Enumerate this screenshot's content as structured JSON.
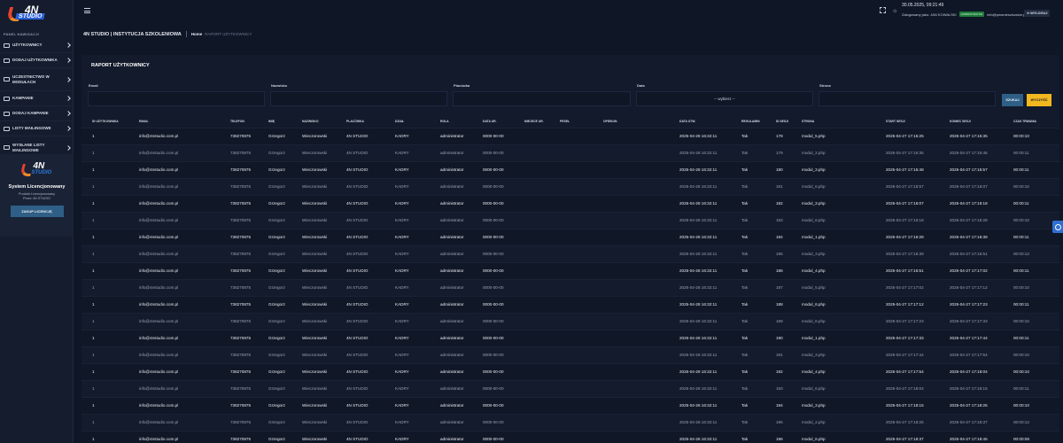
{
  "sidebar": {
    "logo": {
      "mark": "4N",
      "word": "STUDIO"
    },
    "nav_header": "PANEL NAWIGACJI",
    "items": [
      {
        "label": "UŻYTKOWNICY"
      },
      {
        "label": "DODAJ UŻYTKOWNIKA"
      },
      {
        "label": "UCZESTNICTWO W MODUŁACH"
      },
      {
        "label": "KAMPANIE"
      },
      {
        "label": "DODAJ KAMPANIE"
      },
      {
        "label": "LISTY MAILINGOWE"
      },
      {
        "label": "WYSŁANE LISTY MAILINGOWE"
      }
    ],
    "license": {
      "logo_mark": "4N",
      "logo_word": "STUDIO",
      "title": "System Licencjonowany",
      "line1": "Produkt Licencjonowany",
      "line2": "Przez 4N STUDIO",
      "button": "ZAKUP LICENCJĘ"
    }
  },
  "topbar": {
    "datetime": "30.05.2025, 09:21:49",
    "logged_prefix": "Zalogowany jako: JAN KOWALSKI",
    "badge": "ADMINISTRATOR",
    "email": "info@pmanieszkowice.pl",
    "logout": "WYLOGUJ"
  },
  "breadcrumb": {
    "company": "4N STUDIO | INSTYTUCJA SZKOLENIOWA",
    "home": "Home",
    "current": "RAPORT UŻYTKOWNICY"
  },
  "report": {
    "title": "RAPORT UŻYTKOWNICY",
    "filters": {
      "email_label": "Email",
      "surname_label": "Nazwisko",
      "branch_label": "Placówka",
      "date_label": "Data",
      "date_value": "-- wybierz --",
      "page_label": "Strona",
      "search_btn": "SZUKAJ",
      "clear_btn": "WYCZYŚĆ"
    },
    "columns": [
      "ID UŻYTKOWNIKA",
      "EMAIL",
      "TELEFON",
      "IMIĘ",
      "NAZWISKO",
      "PLACÓWKA",
      "DZIAŁ",
      "ROLA",
      "DATA UR.",
      "MIEJSCE UR.",
      "PESEL",
      "OPIEKUN",
      "DATA UTW.",
      "REGULAMIN",
      "ID SESJI",
      "STRONA",
      "START SESJI",
      "KONIEC SESJI",
      "CZAS TRWANIA"
    ],
    "rows": [
      [
        "1",
        "info@4nstudio.com.pl",
        "738270875",
        "Grzegorz",
        "Wieczorowski",
        "4N STUDIO",
        "KADRY",
        "administrator",
        "0000-00-00",
        "",
        "",
        "",
        "2025-04-28 16:32:11",
        "Tak",
        "178",
        "modul_5.php",
        "2025-04-27 17:15:25",
        "2025-04-27 17:15:35",
        "00:00:10"
      ],
      [
        "1",
        "info@4nstudio.com.pl",
        "738270875",
        "Grzegorz",
        "Wieczorowski",
        "4N STUDIO",
        "KADRY",
        "administrator",
        "0000-00-00",
        "",
        "",
        "",
        "2025-04-28 16:32:11",
        "Tak",
        "179",
        "modul_2.php",
        "2025-04-27 17:15:35",
        "2025-04-27 17:15:46",
        "00:00:11"
      ],
      [
        "1",
        "info@4nstudio.com.pl",
        "738270875",
        "Grzegorz",
        "Wieczorowski",
        "4N STUDIO",
        "KADRY",
        "administrator",
        "0000-00-00",
        "",
        "",
        "",
        "2025-04-28 16:32:11",
        "Tak",
        "180",
        "modul_3.php",
        "2025-04-27 17:15:48",
        "2025-04-27 17:15:57",
        "00:00:11"
      ],
      [
        "1",
        "info@4nstudio.com.pl",
        "738270875",
        "Grzegorz",
        "Wieczorowski",
        "4N STUDIO",
        "KADRY",
        "administrator",
        "0000-00-00",
        "",
        "",
        "",
        "2025-04-28 16:32:11",
        "Tak",
        "181",
        "modul_6.php",
        "2025-04-27 17:15:57",
        "2025-04-27 17:16:07",
        "00:00:10"
      ],
      [
        "1",
        "info@4nstudio.com.pl",
        "738270875",
        "Grzegorz",
        "Wieczorowski",
        "4N STUDIO",
        "KADRY",
        "administrator",
        "0000-00-00",
        "",
        "",
        "",
        "2025-04-28 16:32:11",
        "Tak",
        "182",
        "modul_3.php",
        "2025-04-27 17:16:07",
        "2025-04-27 17:16:18",
        "00:00:11"
      ],
      [
        "1",
        "info@4nstudio.com.pl",
        "738270875",
        "Grzegorz",
        "Wieczorowski",
        "4N STUDIO",
        "KADRY",
        "administrator",
        "0000-00-00",
        "",
        "",
        "",
        "2025-04-28 16:32:11",
        "Tak",
        "183",
        "modul_6.php",
        "2025-04-27 17:16:18",
        "2025-04-27 17:16:28",
        "00:00:10"
      ],
      [
        "1",
        "info@4nstudio.com.pl",
        "738270875",
        "Grzegorz",
        "Wieczorowski",
        "4N STUDIO",
        "KADRY",
        "administrator",
        "0000-00-00",
        "",
        "",
        "",
        "2025-04-28 16:32:11",
        "Tak",
        "184",
        "modul_1.php",
        "2025-04-27 17:16:28",
        "2025-04-27 17:16:39",
        "00:00:11"
      ],
      [
        "1",
        "info@4nstudio.com.pl",
        "738270875",
        "Grzegorz",
        "Wieczorowski",
        "4N STUDIO",
        "KADRY",
        "administrator",
        "0000-00-00",
        "",
        "",
        "",
        "2025-04-28 16:32:11",
        "Tak",
        "185",
        "modul_3.php",
        "2025-04-27 17:16:39",
        "2025-04-27 17:16:51",
        "00:00:12"
      ],
      [
        "1",
        "info@4nstudio.com.pl",
        "738270875",
        "Grzegorz",
        "Wieczorowski",
        "4N STUDIO",
        "KADRY",
        "administrator",
        "0000-00-00",
        "",
        "",
        "",
        "2025-04-28 16:32:11",
        "Tak",
        "186",
        "modul_4.php",
        "2025-04-27 17:16:51",
        "2025-04-27 17:17:02",
        "00:00:11"
      ],
      [
        "1",
        "info@4nstudio.com.pl",
        "738270875",
        "Grzegorz",
        "Wieczorowski",
        "4N STUDIO",
        "KADRY",
        "administrator",
        "0000-00-00",
        "",
        "",
        "",
        "2025-04-28 16:32:11",
        "Tak",
        "187",
        "modul_5.php",
        "2025-04-27 17:17:02",
        "2025-04-27 17:17:12",
        "00:00:10"
      ],
      [
        "1",
        "info@4nstudio.com.pl",
        "738270875",
        "Grzegorz",
        "Wieczorowski",
        "4N STUDIO",
        "KADRY",
        "administrator",
        "0000-00-00",
        "",
        "",
        "",
        "2025-04-28 16:32:11",
        "Tak",
        "188",
        "modul_6.php",
        "2025-04-27 17:17:12",
        "2025-04-27 17:17:23",
        "00:00:11"
      ],
      [
        "1",
        "info@4nstudio.com.pl",
        "738270875",
        "Grzegorz",
        "Wieczorowski",
        "4N STUDIO",
        "KADRY",
        "administrator",
        "0000-00-00",
        "",
        "",
        "",
        "2025-04-28 16:32:11",
        "Tak",
        "189",
        "modul_6.php",
        "2025-04-27 17:17:23",
        "2025-04-27 17:17:33",
        "00:00:10"
      ],
      [
        "1",
        "info@4nstudio.com.pl",
        "738270875",
        "Grzegorz",
        "Wieczorowski",
        "4N STUDIO",
        "KADRY",
        "administrator",
        "0000-00-00",
        "",
        "",
        "",
        "2025-04-28 16:32:11",
        "Tak",
        "190",
        "modul_1.php",
        "2025-04-27 17:17:33",
        "2025-04-27 17:17:44",
        "00:00:11"
      ],
      [
        "1",
        "info@4nstudio.com.pl",
        "738270875",
        "Grzegorz",
        "Wieczorowski",
        "4N STUDIO",
        "KADRY",
        "administrator",
        "0000-00-00",
        "",
        "",
        "",
        "2025-04-28 16:32:11",
        "Tak",
        "191",
        "modul_3.php",
        "2025-04-27 17:17:44",
        "2025-04-27 17:17:54",
        "00:00:10"
      ],
      [
        "1",
        "info@4nstudio.com.pl",
        "738270875",
        "Grzegorz",
        "Wieczorowski",
        "4N STUDIO",
        "KADRY",
        "administrator",
        "0000-00-00",
        "",
        "",
        "",
        "2025-04-28 16:32:11",
        "Tak",
        "192",
        "modul_4.php",
        "2025-04-27 17:17:54",
        "2025-04-27 17:18:04",
        "00:00:10"
      ],
      [
        "1",
        "info@4nstudio.com.pl",
        "738270875",
        "Grzegorz",
        "Wieczorowski",
        "4N STUDIO",
        "KADRY",
        "administrator",
        "0000-00-00",
        "",
        "",
        "",
        "2025-04-28 16:32:11",
        "Tak",
        "193",
        "modul_6.php",
        "2025-04-27 17:18:04",
        "2025-04-27 17:18:15",
        "00:00:11"
      ],
      [
        "1",
        "info@4nstudio.com.pl",
        "738270875",
        "Grzegorz",
        "Wieczorowski",
        "4N STUDIO",
        "KADRY",
        "administrator",
        "0000-00-00",
        "",
        "",
        "",
        "2025-04-28 16:32:11",
        "Tak",
        "194",
        "modul_3.php",
        "2025-04-27 17:18:15",
        "2025-04-27 17:18:25",
        "00:00:10"
      ],
      [
        "1",
        "info@4nstudio.com.pl",
        "738270875",
        "Grzegorz",
        "Wieczorowski",
        "4N STUDIO",
        "KADRY",
        "administrator",
        "0000-00-00",
        "",
        "",
        "",
        "2025-04-28 16:32:11",
        "Tak",
        "195",
        "modul_2.php",
        "2025-04-27 17:18:25",
        "2025-04-27 17:18:37",
        "00:00:12"
      ],
      [
        "1",
        "info@4nstudio.com.pl",
        "738270875",
        "Grzegorz",
        "Wieczorowski",
        "4N STUDIO",
        "KADRY",
        "administrator",
        "0000-00-00",
        "",
        "",
        "",
        "2025-04-28 16:32:11",
        "Tak",
        "196",
        "modul_6.php",
        "2025-04-27 17:18:37",
        "2025-04-27 17:18:45",
        "00:00:08"
      ]
    ]
  }
}
